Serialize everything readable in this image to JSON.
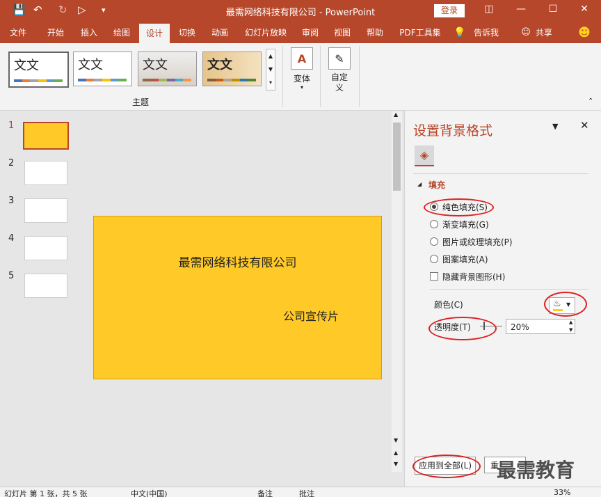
{
  "app": {
    "title": "最需网络科技有限公司  -  PowerPoint",
    "login_label": "登录"
  },
  "tabs": [
    {
      "label": "文件"
    },
    {
      "label": "开始"
    },
    {
      "label": "插入"
    },
    {
      "label": "绘图"
    },
    {
      "label": "设计"
    },
    {
      "label": "切换"
    },
    {
      "label": "动画"
    },
    {
      "label": "幻灯片放映"
    },
    {
      "label": "审阅"
    },
    {
      "label": "视图"
    },
    {
      "label": "帮助"
    },
    {
      "label": "PDF工具集"
    },
    {
      "label": "告诉我"
    },
    {
      "label": "共享"
    }
  ],
  "ribbon": {
    "themes": [
      {
        "text": "文文"
      },
      {
        "text": "文文"
      },
      {
        "text": "文文"
      },
      {
        "text": "文文"
      }
    ],
    "group_label": "主题",
    "variant_label": "变体",
    "custom_label": "自定义"
  },
  "slides": [
    "1",
    "2",
    "3",
    "4",
    "5"
  ],
  "slide": {
    "title": "最需网络科技有限公司",
    "subtitle": "公司宣传片",
    "bg_color": "#ffc928"
  },
  "pane": {
    "title": "设置背景格式",
    "section": "填充",
    "options": {
      "solid": "纯色填充(S)",
      "gradient": "渐变填充(G)",
      "picture": "图片或纹理填充(P)",
      "pattern": "图案填充(A)",
      "hide_bg": "隐藏背景图形(H)"
    },
    "color_label": "颜色(C)",
    "transparency_label": "透明度(T)",
    "transparency_value": "20%",
    "apply_all": "应用到全部(L)",
    "reset": "重"
  },
  "status": {
    "slide_info": "幻灯片 第 1 张，共 5 张",
    "lang": "中文(中国)",
    "notes": "备注",
    "comments": "批注",
    "zoom": "33%"
  },
  "watermark": "最需教育",
  "colors": {
    "accent": "#b7472a",
    "annotation": "#e02020"
  }
}
